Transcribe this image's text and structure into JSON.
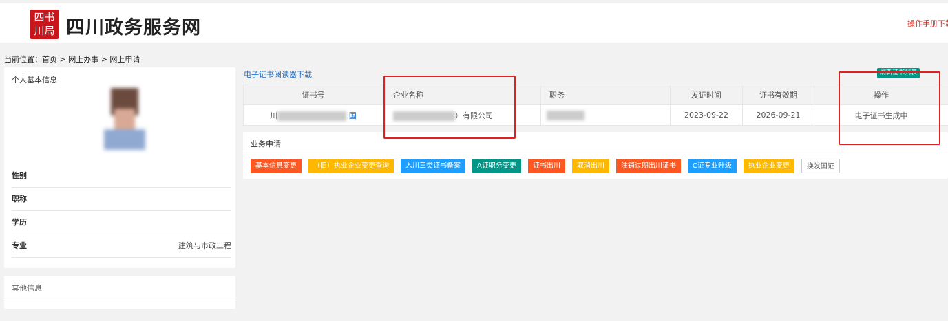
{
  "header": {
    "site_title": "四川政务服务网",
    "logo_text": "四川书局",
    "manual_link": "操作手册下载"
  },
  "breadcrumb": "当前位置：首页 > 网上办事 > 网上申请",
  "personal": {
    "title": "个人基本信息",
    "fields": [
      {
        "label": "性别",
        "value": ""
      },
      {
        "label": "职称",
        "value": ""
      },
      {
        "label": "学历",
        "value": ""
      },
      {
        "label": "专业",
        "value": "建筑与市政工程"
      }
    ]
  },
  "other": {
    "title": "其他信息"
  },
  "reader_link": "电子证书阅读器下载",
  "refresh_button": "刷新证书列表",
  "table": {
    "headers": [
      "证书号",
      "企业名称",
      "职务",
      "发证时间",
      "证书有效期",
      "操作"
    ],
    "rows": [
      {
        "cert_no_prefix": "川",
        "cert_no_suffix": "国",
        "company_suffix": "）有限公司",
        "issue_date": "2023-09-22",
        "expiry": "2026-09-21",
        "action": "电子证书生成中"
      }
    ]
  },
  "business": {
    "title": "业务申请",
    "buttons": [
      {
        "label": "基本信息变更",
        "color": "#ff5722"
      },
      {
        "label": "（旧）执业企业变更查询",
        "color": "#ffb800"
      },
      {
        "label": "入川三类证书备案",
        "color": "#1e9fff"
      },
      {
        "label": "A证职务变更",
        "color": "#009688"
      },
      {
        "label": "证书出川",
        "color": "#ff5722"
      },
      {
        "label": "取消出川",
        "color": "#ffb800"
      },
      {
        "label": "注销过期出川证书",
        "color": "#ff5722"
      },
      {
        "label": "C证专业升级",
        "color": "#1e9fff"
      },
      {
        "label": "执业企业变更",
        "color": "#ffb800"
      },
      {
        "label": "换发国证",
        "color": "#ffffff"
      }
    ]
  },
  "annotation_color": "#e02020"
}
